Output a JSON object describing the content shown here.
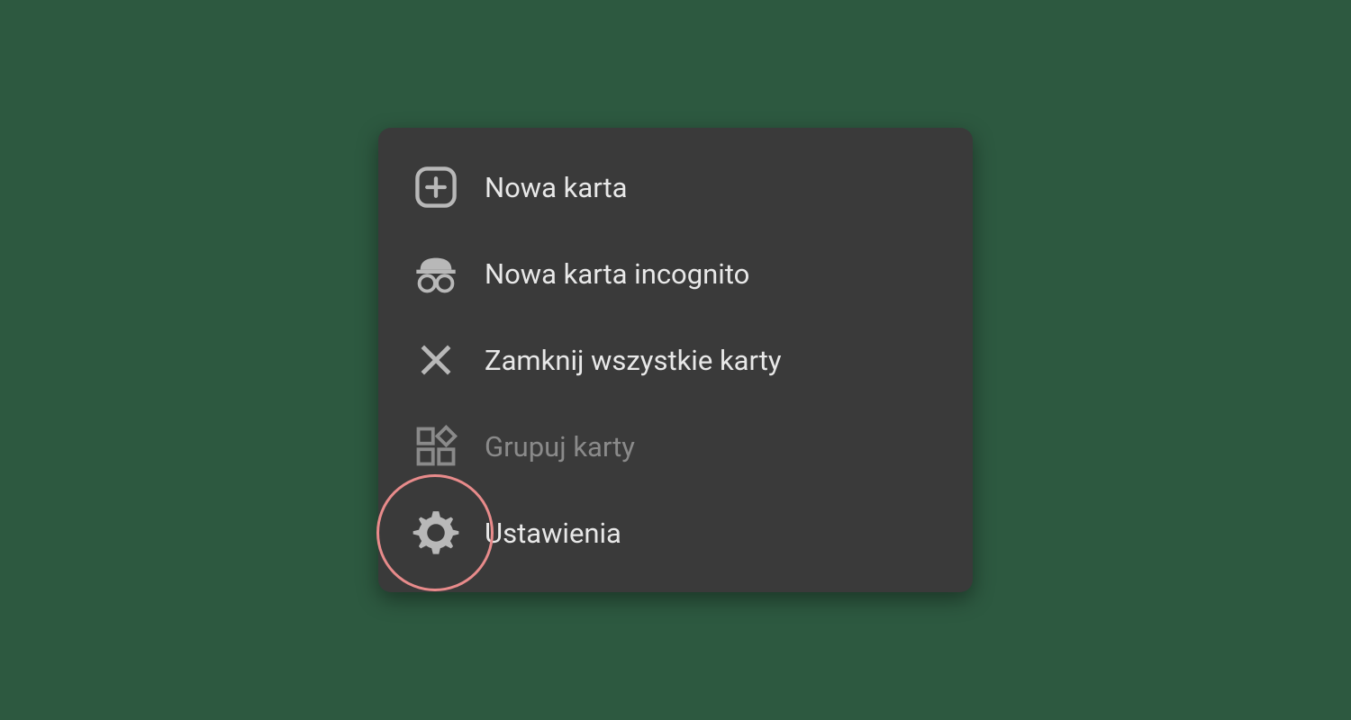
{
  "menu": {
    "items": [
      {
        "label": "Nowa karta",
        "icon": "plus-icon",
        "disabled": false,
        "highlighted": false
      },
      {
        "label": "Nowa karta incognito",
        "icon": "incognito-icon",
        "disabled": false,
        "highlighted": false
      },
      {
        "label": "Zamknij wszystkie karty",
        "icon": "close-icon",
        "disabled": false,
        "highlighted": false
      },
      {
        "label": "Grupuj karty",
        "icon": "group-icon",
        "disabled": true,
        "highlighted": false
      },
      {
        "label": "Ustawienia",
        "icon": "gear-icon",
        "disabled": false,
        "highlighted": true
      }
    ]
  },
  "colors": {
    "background": "#2d5940",
    "menu_bg": "#3a3a3a",
    "text": "#e8e8e8",
    "text_disabled": "#8a8a8a",
    "icon": "#b8b8b8",
    "highlight_ring": "#e88b8b"
  }
}
